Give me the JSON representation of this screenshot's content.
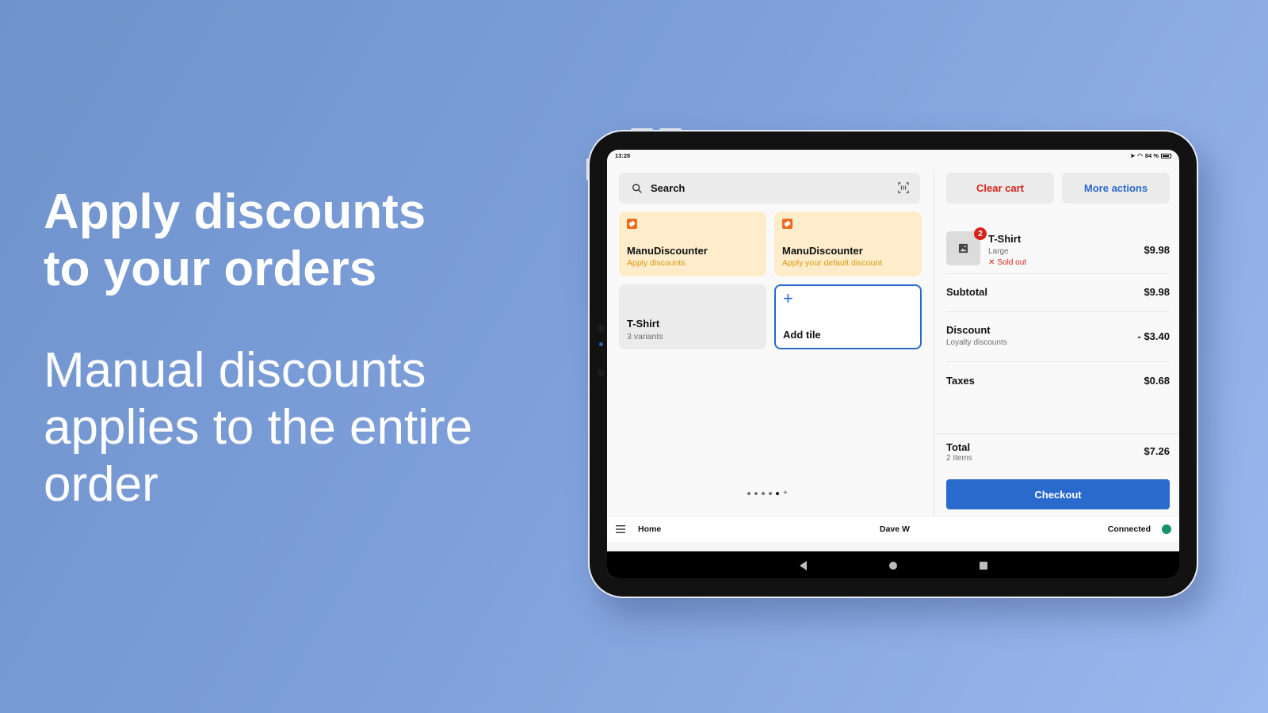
{
  "promo": {
    "headline_line1": "Apply discounts",
    "headline_line2": "to your orders",
    "subtext": "Manual discounts applies to the entire order"
  },
  "device": {
    "status_bar": {
      "time": "13:28",
      "battery": "84 %",
      "icons": [
        "location-icon",
        "wifi-icon",
        "battery-icon"
      ]
    }
  },
  "pos": {
    "search": {
      "placeholder": "Search",
      "scan_icon": "barcode-scan-icon"
    },
    "tiles": [
      {
        "type": "discount",
        "title": "ManuDiscounter",
        "subtitle": "Apply discounts",
        "icon": "discount-tag-icon"
      },
      {
        "type": "discount",
        "title": "ManuDiscounter",
        "subtitle": "Apply your default discount",
        "icon": "discount-tag-icon"
      },
      {
        "type": "product",
        "title": "T-Shirt",
        "subtitle": "3 variants"
      },
      {
        "type": "add",
        "title": "Add tile",
        "icon": "plus-icon"
      }
    ],
    "pager": {
      "pages": 5,
      "active_page": 5
    },
    "cart": {
      "clear_label": "Clear cart",
      "more_label": "More actions",
      "line_item": {
        "name": "T-Shirt",
        "variant": "Large",
        "status": "Sold out",
        "quantity": "2",
        "price": "$9.98"
      },
      "subtotal": {
        "label": "Subtotal",
        "value": "$9.98"
      },
      "discount": {
        "label": "Discount",
        "sub": "Loyalty discounts",
        "value": "- $3.40"
      },
      "taxes": {
        "label": "Taxes",
        "value": "$0.68"
      },
      "total": {
        "label": "Total",
        "sub": "2 Items",
        "value": "$7.26"
      },
      "checkout_label": "Checkout"
    },
    "bottom_bar": {
      "home_label": "Home",
      "user": "Dave W",
      "connection": "Connected",
      "connection_color": "#15936a"
    }
  },
  "colors": {
    "accent": "#2a6acc",
    "danger": "#d4241c",
    "discount_tile": "#feeccb",
    "discount_text": "#d99a0a"
  }
}
